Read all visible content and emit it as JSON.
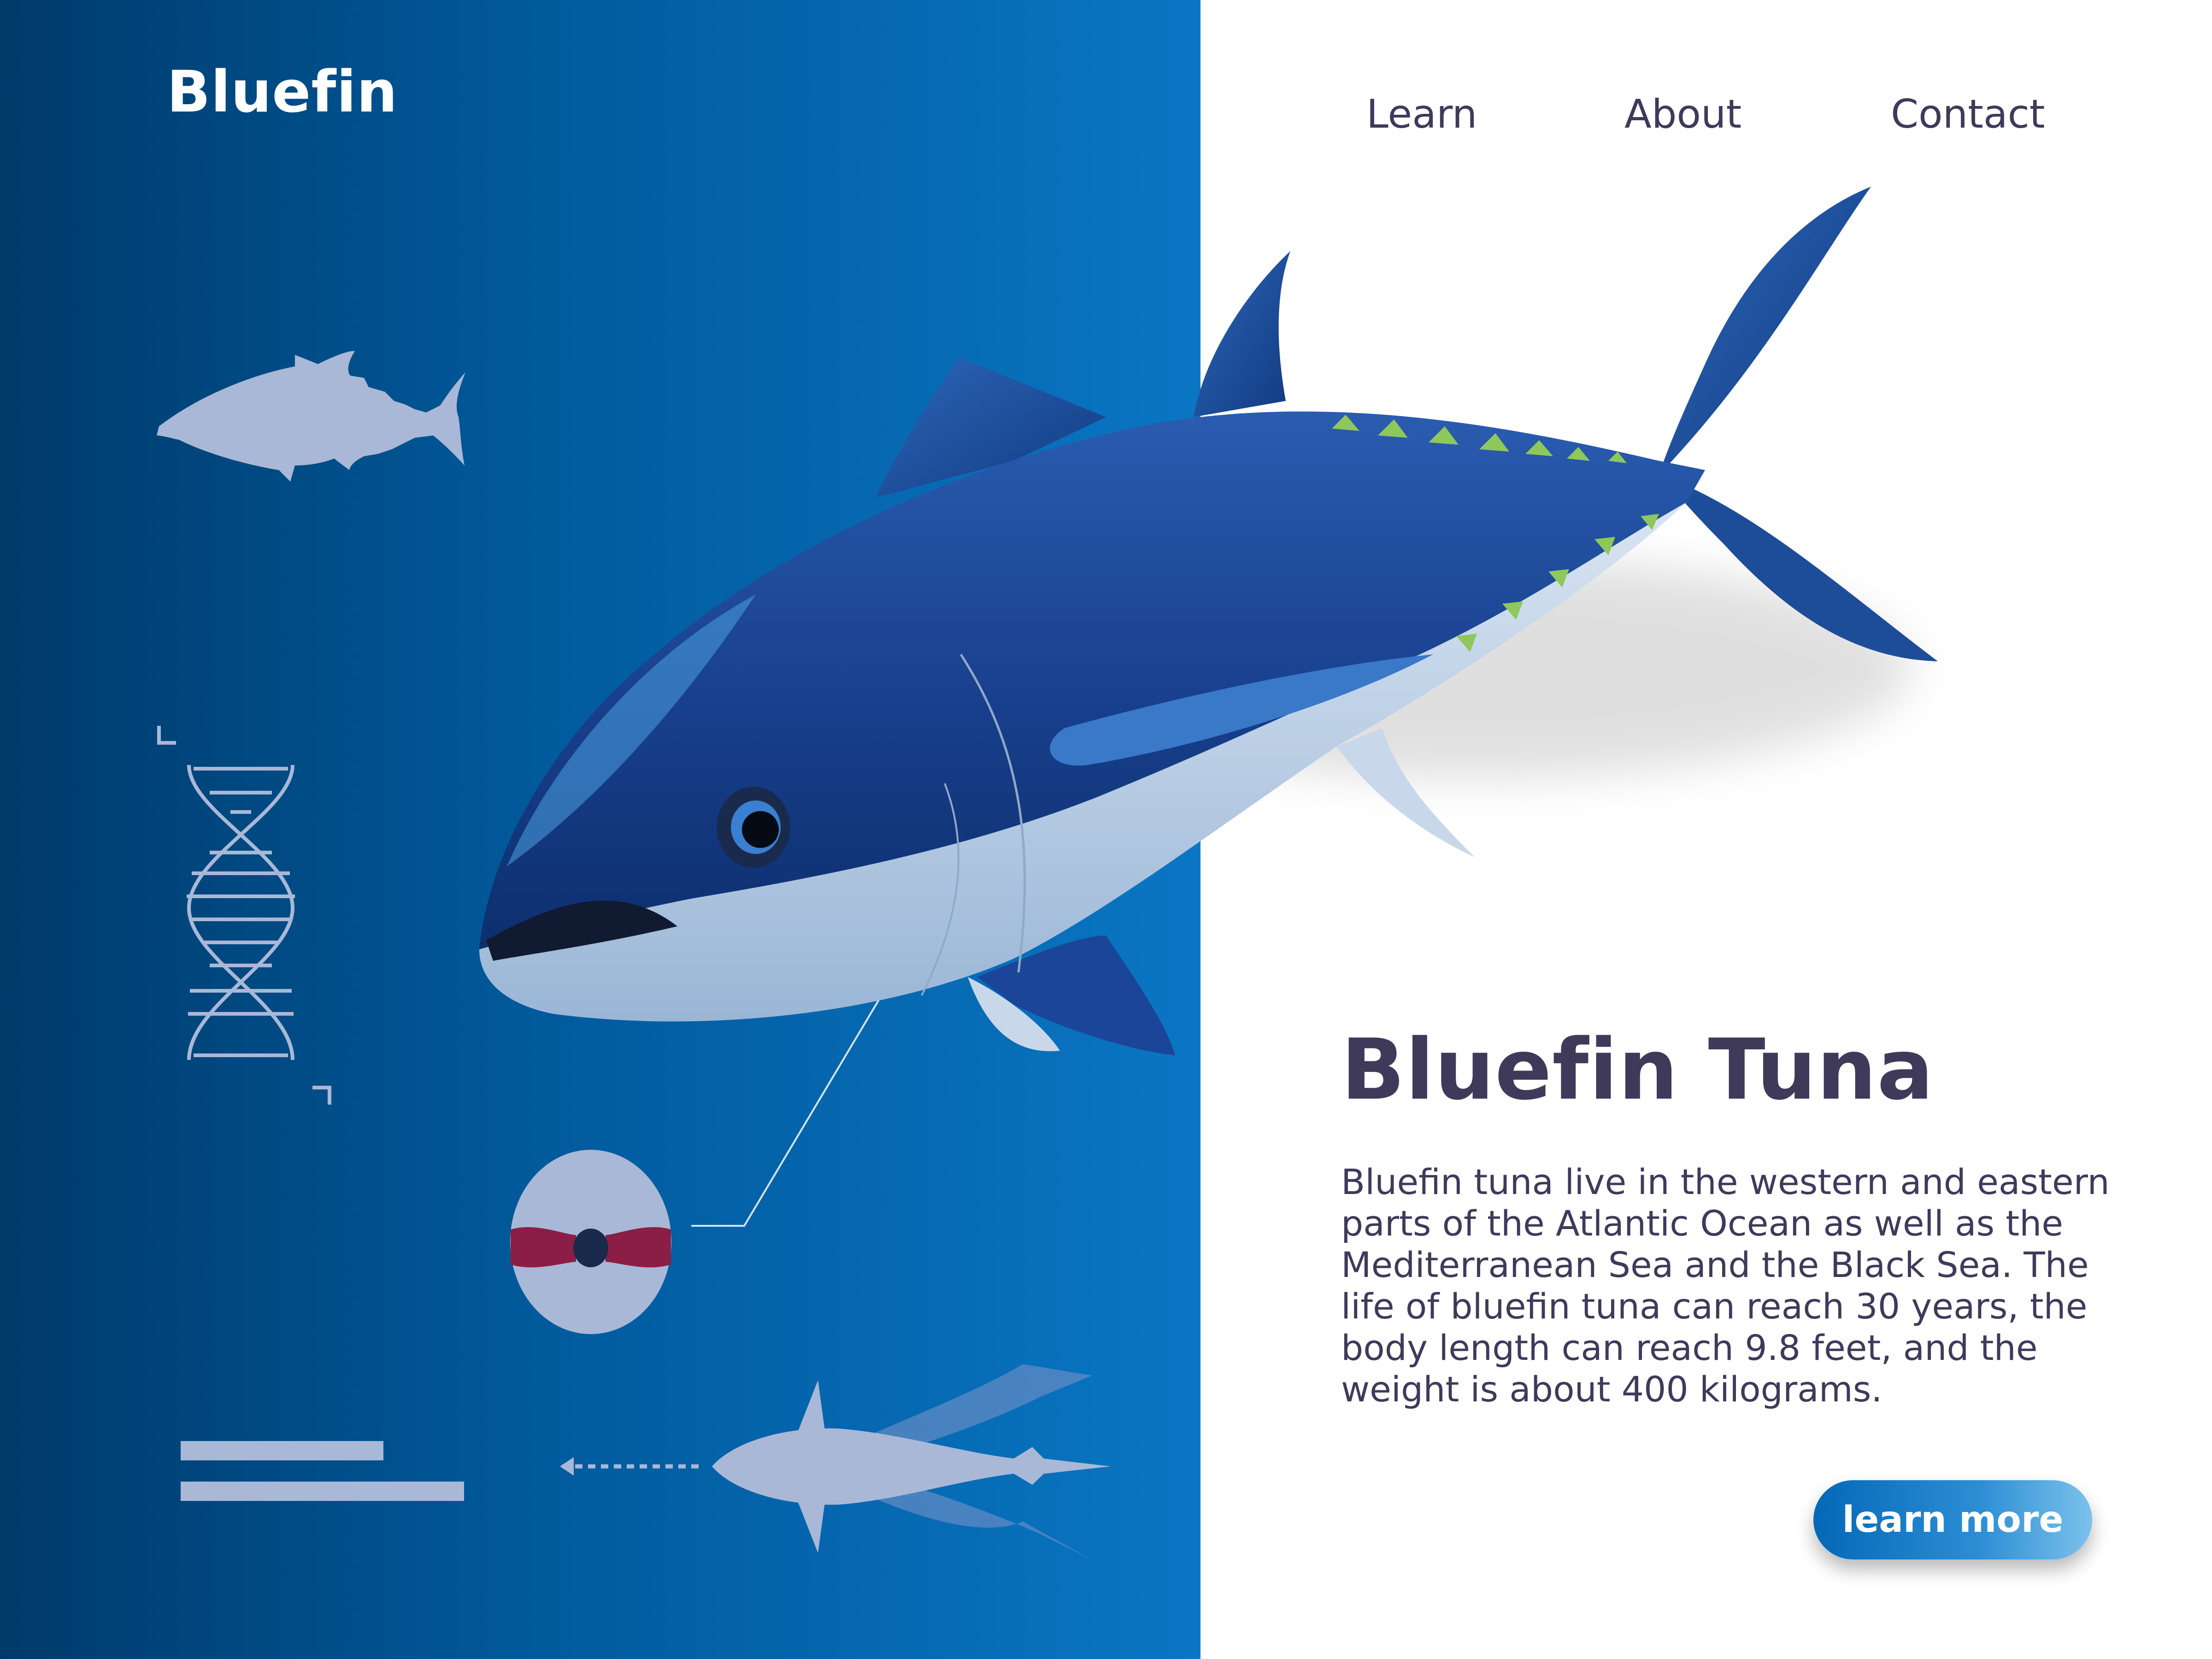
{
  "brand": "Bluefin",
  "nav": {
    "items": [
      "Learn",
      "About",
      "Contact"
    ]
  },
  "hero": {
    "title": "Bluefin Tuna",
    "description_lines": [
      "Bluefin tuna live in the western and eastern",
      "parts of the Atlantic Ocean as well as the",
      "Mediterranean Sea and the Black Sea. The",
      "life of bluefin tuna can reach 30 years, the",
      "body length can reach 9.8 feet, and the",
      "weight is about 400 kilograms."
    ],
    "cta_label": "learn more"
  },
  "icons": {
    "fish_silhouette": "tuna-silhouette-icon",
    "dna": "dna-helix-icon",
    "cross_section": "body-cross-section-icon",
    "swimming": "swimming-motion-icon",
    "text_placeholder": "text-lines-icon"
  },
  "colors": {
    "panel_dark": "#003a6b",
    "panel_light": "#0a76c4",
    "text_dark": "#3f3a5a",
    "fish_back": "#1f4f9e",
    "fish_belly": "#a8c4e0",
    "finlets": "#8fc85a",
    "icon_fill": "#a9b8d6",
    "muscle": "#8b1e45"
  }
}
